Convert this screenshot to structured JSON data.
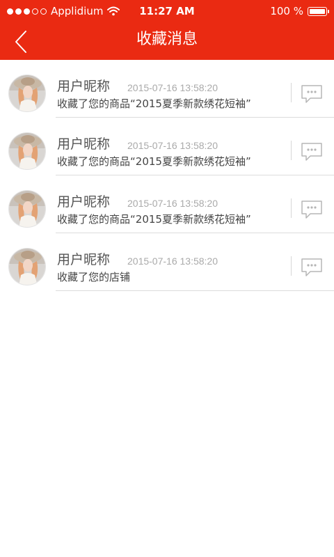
{
  "status_bar": {
    "carrier": "Applidium",
    "time": "11:27 AM",
    "battery_text": "100 %",
    "signal_full": 3,
    "signal_total": 5,
    "battery_level": 1.0
  },
  "header": {
    "title": "收藏消息",
    "background": "#ea2a12",
    "back_icon": "chevron-left-icon"
  },
  "notifications": [
    {
      "name": "用户昵称",
      "time": "2015-07-16 13:58:20",
      "message": "收藏了您的商品“2015夏季新款绣花短袖”",
      "icon": "chat-bubble-icon"
    },
    {
      "name": "用户昵称",
      "time": "2015-07-16 13:58:20",
      "message": "收藏了您的商品“2015夏季新款绣花短袖”",
      "icon": "chat-bubble-icon"
    },
    {
      "name": "用户昵称",
      "time": "2015-07-16 13:58:20",
      "message": "收藏了您的商品“2015夏季新款绣花短袖”",
      "icon": "chat-bubble-icon"
    },
    {
      "name": "用户昵称",
      "time": "2015-07-16 13:58:20",
      "message": "收藏了您的店铺",
      "icon": "chat-bubble-icon"
    }
  ]
}
